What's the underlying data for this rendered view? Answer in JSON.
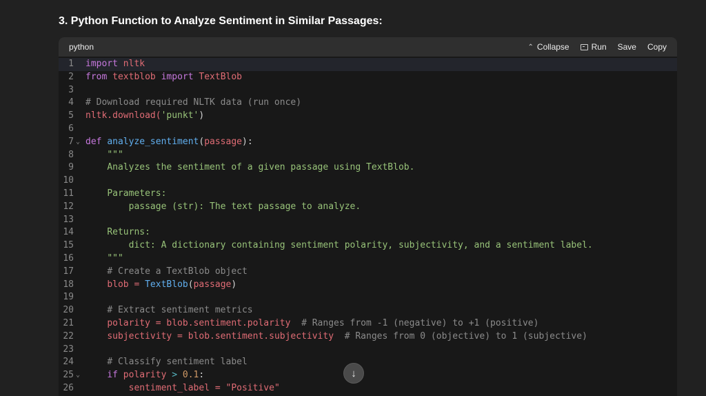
{
  "heading": "3. Python Function to Analyze Sentiment in Similar Passages:",
  "code_block": {
    "language": "python",
    "toolbar": {
      "collapse_icon": "⌃",
      "collapse_label": "Collapse",
      "run_label": "Run",
      "save_label": "Save",
      "copy_label": "Copy"
    },
    "lines": [
      {
        "n": "1",
        "fold": ""
      },
      {
        "n": "2",
        "fold": ""
      },
      {
        "n": "3",
        "fold": ""
      },
      {
        "n": "4",
        "fold": ""
      },
      {
        "n": "5",
        "fold": ""
      },
      {
        "n": "6",
        "fold": ""
      },
      {
        "n": "7",
        "fold": "⌄"
      },
      {
        "n": "8",
        "fold": ""
      },
      {
        "n": "9",
        "fold": ""
      },
      {
        "n": "10",
        "fold": ""
      },
      {
        "n": "11",
        "fold": ""
      },
      {
        "n": "12",
        "fold": ""
      },
      {
        "n": "13",
        "fold": ""
      },
      {
        "n": "14",
        "fold": ""
      },
      {
        "n": "15",
        "fold": ""
      },
      {
        "n": "16",
        "fold": ""
      },
      {
        "n": "17",
        "fold": ""
      },
      {
        "n": "18",
        "fold": ""
      },
      {
        "n": "19",
        "fold": ""
      },
      {
        "n": "20",
        "fold": ""
      },
      {
        "n": "21",
        "fold": ""
      },
      {
        "n": "22",
        "fold": ""
      },
      {
        "n": "23",
        "fold": ""
      },
      {
        "n": "24",
        "fold": ""
      },
      {
        "n": "25",
        "fold": "⌄"
      },
      {
        "n": "26",
        "fold": ""
      }
    ],
    "tokens": {
      "import": "import",
      "from": "from",
      "def": "def",
      "if": "if",
      "nltk": "nltk",
      "textblob": "textblob",
      "TextBlob": "TextBlob",
      "cmt_download": "# Download required NLTK data (run once)",
      "nltk_download": "nltk.download(",
      "punkt": "'punkt'",
      "close_paren": ")",
      "analyze_sentiment": "analyze_sentiment",
      "paren_open": "(",
      "passage_param": "passage",
      "paren_close_colon": "):",
      "triple_quote": "\"\"\"",
      "doc_line1": "Analyzes the sentiment of a given passage using TextBlob.",
      "doc_params": "Parameters:",
      "doc_param_passage": "passage (str): The text passage to analyze.",
      "doc_returns": "Returns:",
      "doc_return_dict": "dict: A dictionary containing sentiment polarity, subjectivity, and a sentiment label.",
      "cmt_create": "# Create a TextBlob object",
      "blob_assign": "blob = ",
      "passage_arg": "passage",
      "cmt_extract": "# Extract sentiment metrics",
      "polarity_assign": "polarity = blob.sentiment.polarity",
      "cmt_polarity": "# Ranges from -1 (negative) to +1 (positive)",
      "subjectivity_assign": "subjectivity = blob.sentiment.subjectivity",
      "cmt_subjectivity": "# Ranges from 0 (objective) to 1 (subjective)",
      "cmt_classify": "# Classify sentiment label",
      "polarity_var": "polarity",
      "gt": ">",
      "num_01": "0.1",
      "colon": ":",
      "line26_partial": "sentiment_label = \"Positive\""
    }
  },
  "scroll_down_icon": "↓",
  "colors": {
    "background": "#212121",
    "code_bg": "#181818",
    "header_bg": "#2f2f2f",
    "keyword": "#c678dd",
    "string": "#98c379",
    "function": "#61afef",
    "variable": "#e06c75",
    "comment": "#8b8b8b",
    "number": "#d19a66"
  }
}
